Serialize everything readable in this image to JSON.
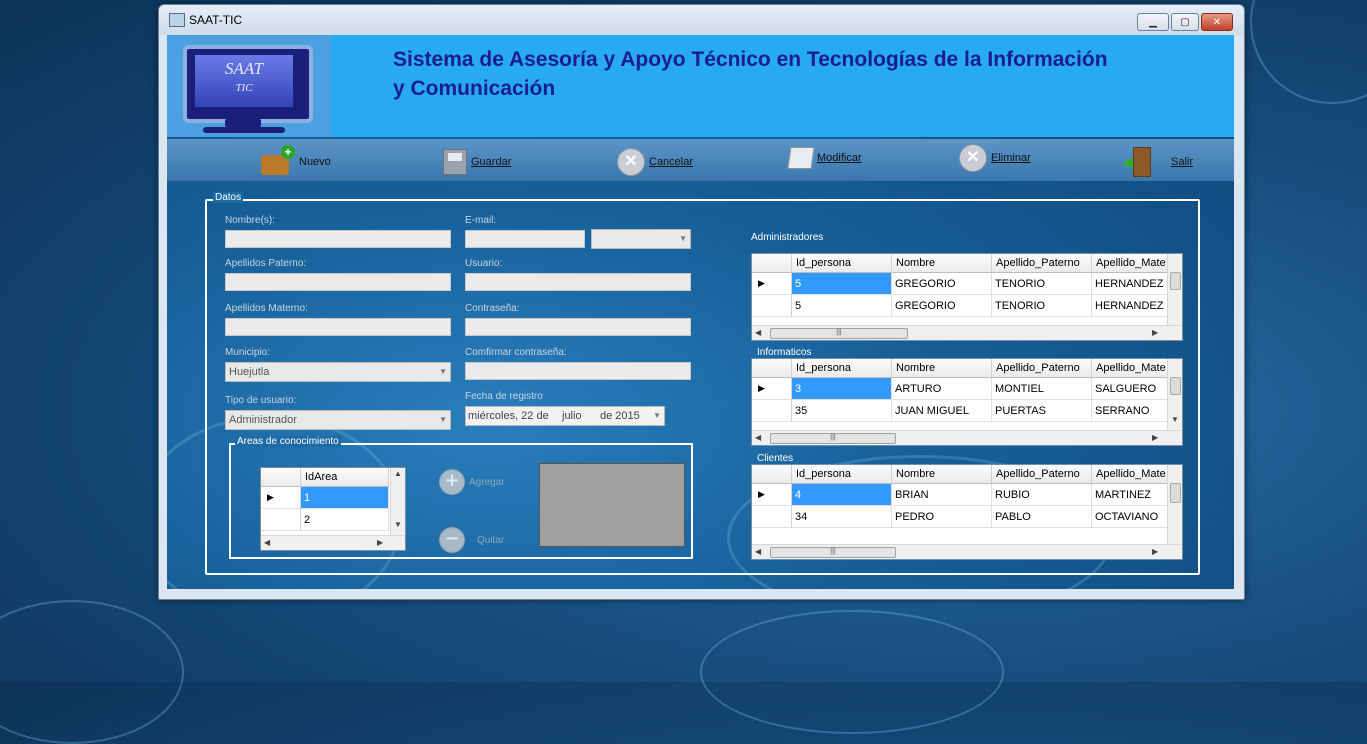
{
  "window": {
    "title": "SAAT-TIC"
  },
  "header": {
    "logo_text": "SAAT",
    "logo_sub": "TIC",
    "title": "Sistema de Asesoría y Apoyo Técnico en Tecnologías de la Información y Comunicación"
  },
  "toolbar": {
    "nuevo": "Nuevo",
    "guardar": "Guardar",
    "cancelar": "Cancelar",
    "modificar": "Modificar",
    "eliminar": "Eliminar",
    "salir": "Salir"
  },
  "datos": {
    "legend": "Datos",
    "nombre_label": "Nombre(s):",
    "nombre_value": "",
    "email_label": "E-mail:",
    "email_value": "",
    "email_domain_value": "",
    "ap_paterno_label": "Apellidos Paterno:",
    "usuario_label": "Usuario:",
    "ap_materno_label": "Apellidos Materno:",
    "contrasena_label": "Contraseña:",
    "municipio_label": "Municipio:",
    "municipio_value": "Huejutla",
    "confirmar_label": "Comfirmar contraseña:",
    "tipo_label": "Tipo de usuario:",
    "tipo_value": "Administrador",
    "fecha_label": "Fecha de registro",
    "fecha_day": "miércoles, 22 de",
    "fecha_month": "julio",
    "fecha_year": "de 2015"
  },
  "areas": {
    "legend": "Areas de conocimiento",
    "column": "IdArea",
    "rows": [
      "1",
      "2"
    ],
    "agregar": "Agregar",
    "quitar": "Quitar"
  },
  "grids": {
    "columns": [
      "Id_persona",
      "Nombre",
      "Apellido_Paterno",
      "Apellido_Mate"
    ],
    "administradores": {
      "label": "Administradores",
      "rows": [
        [
          "5",
          "GREGORIO",
          "TENORIO",
          "HERNANDEZ"
        ],
        [
          "5",
          "GREGORIO",
          "TENORIO",
          "HERNANDEZ"
        ]
      ]
    },
    "informaticos": {
      "label": "Informaticos",
      "rows": [
        [
          "3",
          "ARTURO",
          "MONTIEL",
          "SALGUERO"
        ],
        [
          "35",
          "JUAN MIGUEL",
          "PUERTAS",
          "SERRANO"
        ]
      ]
    },
    "clientes": {
      "label": "Clientes",
      "rows": [
        [
          "4",
          "BRIAN",
          "RUBIO",
          "MARTINEZ"
        ],
        [
          "34",
          "PEDRO",
          "PABLO",
          "OCTAVIANO"
        ]
      ]
    }
  }
}
